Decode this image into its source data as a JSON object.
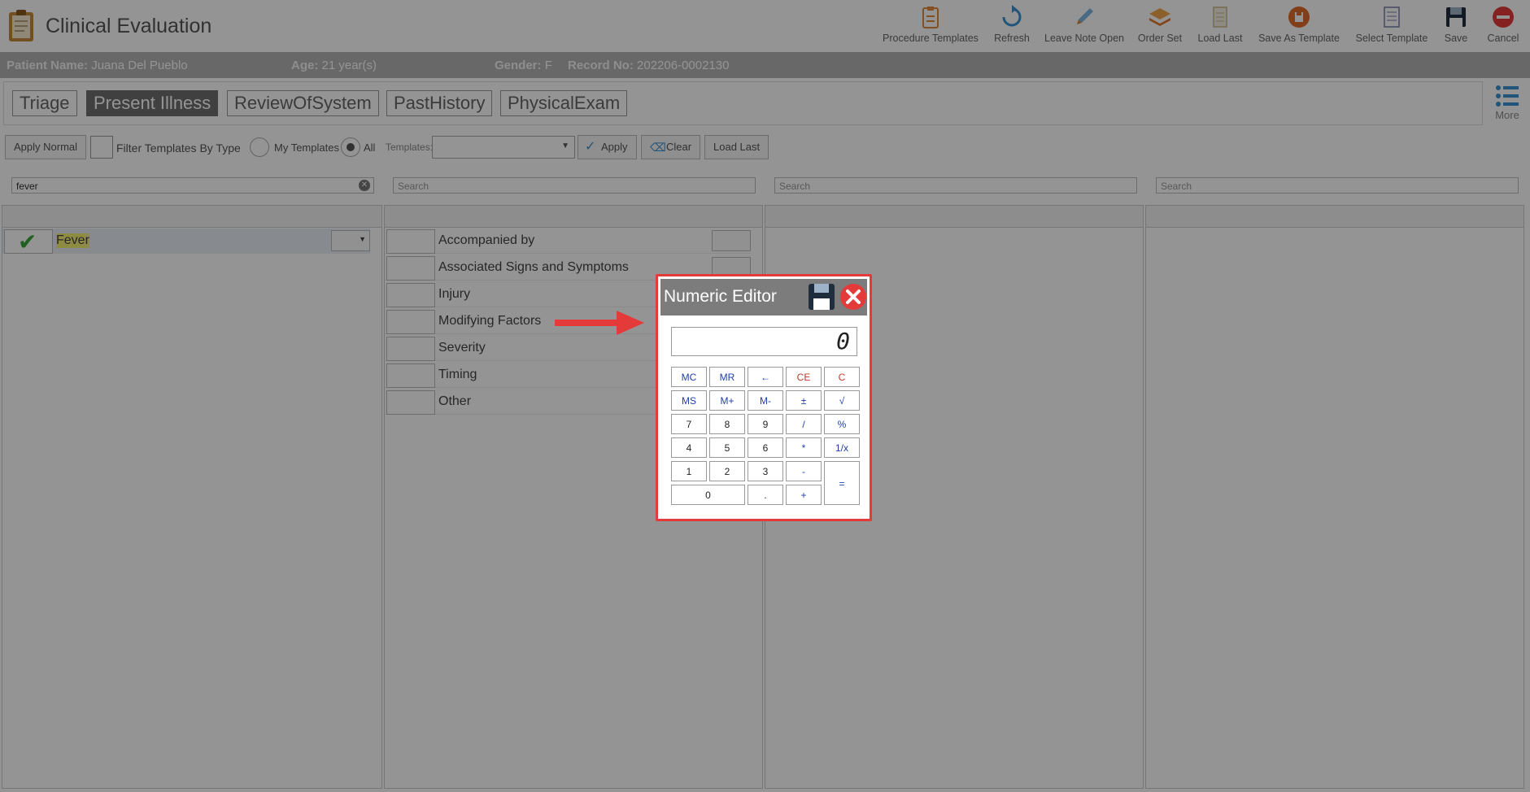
{
  "app": {
    "title": "Clinical Evaluation"
  },
  "toolbar": [
    {
      "label": "Procedure Templates",
      "icon": "clipboard-icon"
    },
    {
      "label": "Refresh",
      "icon": "refresh-icon"
    },
    {
      "label": "Leave Note Open",
      "icon": "pen-icon"
    },
    {
      "label": "Order Set",
      "icon": "layers-icon"
    },
    {
      "label": "Load Last",
      "icon": "document-icon"
    },
    {
      "label": "Save As Template",
      "icon": "save-template-icon"
    },
    {
      "label": "Select Template",
      "icon": "list-document-icon"
    },
    {
      "label": "Save",
      "icon": "floppy-icon"
    },
    {
      "label": "Cancel",
      "icon": "cancel-icon"
    }
  ],
  "patient": {
    "name_label": "Patient Name:",
    "name": "Juana Del Pueblo",
    "age_label": "Age:",
    "age": "21 year(s)",
    "gender_label": "Gender:",
    "gender": "F",
    "record_label": "Record No:",
    "record": "202206-0002130"
  },
  "tabs": [
    {
      "label": "Triage",
      "active": false
    },
    {
      "label": "Present Illness",
      "active": true
    },
    {
      "label": "ReviewOfSystem",
      "active": false
    },
    {
      "label": "PastHistory",
      "active": false
    },
    {
      "label": "PhysicalExam",
      "active": false
    }
  ],
  "more_label": "More",
  "filters": {
    "apply_normal": "Apply Normal",
    "filter_by_type": "Filter Templates By Type",
    "my_templates": "My Templates",
    "all": "All",
    "templates_label": "Templates:",
    "apply": "Apply",
    "clear": "Clear",
    "load_last": "Load Last"
  },
  "search": {
    "col1_value": "fever",
    "placeholder": "Search"
  },
  "col1_rows": [
    {
      "label": "Fever",
      "checked": true
    }
  ],
  "col2_rows": [
    {
      "label": "Accompanied by"
    },
    {
      "label": "Associated Signs and Symptoms"
    },
    {
      "label": "Injury"
    },
    {
      "label": "Modifying Factors"
    },
    {
      "label": "Severity"
    },
    {
      "label": "Timing"
    },
    {
      "label": "Other"
    }
  ],
  "numeric_editor": {
    "title": "Numeric Editor",
    "display_value": "0",
    "keys": {
      "mc": "MC",
      "mr": "MR",
      "back": "←",
      "ce": "CE",
      "c": "C",
      "ms": "MS",
      "mplus": "M+",
      "mminus": "M-",
      "plusminus": "±",
      "sqrt": "√",
      "k7": "7",
      "k8": "8",
      "k9": "9",
      "div": "/",
      "pct": "%",
      "k4": "4",
      "k5": "5",
      "k6": "6",
      "mul": "*",
      "inv": "1/x",
      "k1": "1",
      "k2": "2",
      "k3": "3",
      "sub": "-",
      "k0": "0",
      "dot": ".",
      "add": "+",
      "eq": "="
    }
  },
  "colors": {
    "accent": "#e53a3a",
    "header_gray": "#7c7c7c",
    "patient_bar": "#b3b3b3",
    "key_blue": "#1f3fa8",
    "key_red": "#c0392b"
  }
}
